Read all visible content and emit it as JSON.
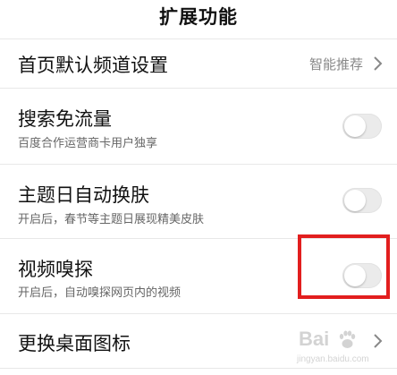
{
  "header": {
    "title": "扩展功能"
  },
  "settings": [
    {
      "title": "首页默认频道设置",
      "value": "智能推荐",
      "control": "chevron"
    },
    {
      "title": "搜索免流量",
      "subtitle": "百度合作运营商卡用户独享",
      "control": "toggle",
      "enabled": false
    },
    {
      "title": "主题日自动换肤",
      "subtitle": "开启后，春节等主题日展现精美皮肤",
      "control": "toggle",
      "enabled": false
    },
    {
      "title": "视频嗅探",
      "subtitle": "开启后，自动嗅探网页内的视频",
      "control": "toggle",
      "enabled": false
    },
    {
      "title": "更换桌面图标",
      "control": "chevron"
    }
  ],
  "annotation": {
    "highlight_color": "#e21e1e"
  },
  "watermark": {
    "logo_text": "Bai",
    "sub_text": "jingyan.baidu.com"
  },
  "colors": {
    "toggle_off": "#ebebeb",
    "divider": "#e8e8e8",
    "secondary_text": "#666666",
    "value_text": "#888888"
  },
  "icons": [
    "chevron-right-icon",
    "toggle-switch",
    "baidu-paw-icon"
  ]
}
